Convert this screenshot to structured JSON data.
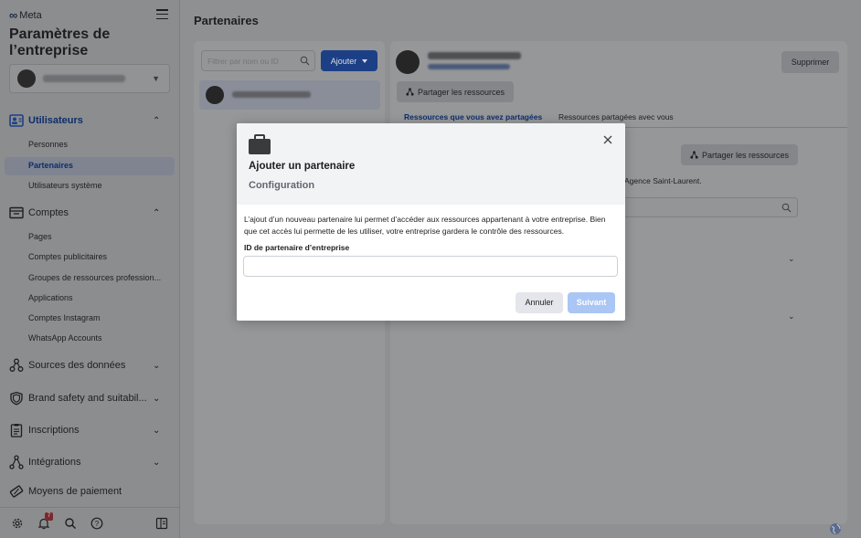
{
  "sidebar": {
    "brand": "Meta",
    "title": "Paramètres de l’entreprise",
    "account_selector": {
      "name_blurred": true
    },
    "sections": [
      {
        "id": "utilisateurs",
        "label": "Utilisateurs",
        "icon": "users-icon",
        "expanded": true,
        "active": true
      },
      {
        "id": "comptes",
        "label": "Comptes",
        "icon": "accounts-folder-icon",
        "expanded": true,
        "active": false
      },
      {
        "id": "sources",
        "label": "Sources des données",
        "icon": "data-sources-icon",
        "expanded": false,
        "active": false
      },
      {
        "id": "brand-safety",
        "label": "Brand safety and suitabil...",
        "icon": "shield-icon",
        "expanded": false,
        "active": false
      },
      {
        "id": "inscriptions",
        "label": "Inscriptions",
        "icon": "clipboard-icon",
        "expanded": false,
        "active": false
      },
      {
        "id": "integrations",
        "label": "Intégrations",
        "icon": "integrations-icon",
        "expanded": false,
        "active": false
      },
      {
        "id": "paiement",
        "label": "Moyens de paiement",
        "icon": "payment-icon",
        "expanded": false,
        "active": false
      }
    ],
    "users_items": [
      {
        "label": "Personnes",
        "active": false
      },
      {
        "label": "Partenaires",
        "active": true
      },
      {
        "label": "Utilisateurs système",
        "active": false
      }
    ],
    "accounts_items": [
      {
        "label": "Pages"
      },
      {
        "label": "Comptes publicitaires"
      },
      {
        "label": "Groupes de ressources profession..."
      },
      {
        "label": "Applications"
      },
      {
        "label": "Comptes Instagram"
      },
      {
        "label": "WhatsApp Accounts"
      }
    ],
    "bottom_icons": [
      "gear-icon",
      "bell-icon",
      "search-icon",
      "help-icon",
      "panel-toggle-icon"
    ],
    "notification_count": "7"
  },
  "main": {
    "page_title": "Partenaires",
    "filter_placeholder": "Filtrer par nom ou ID",
    "add_button": "Ajouter",
    "partner_list": [
      {
        "name_blurred": true,
        "selected": true
      }
    ],
    "detail": {
      "delete_button": "Supprimer",
      "share_button": "Partager les ressources",
      "tabs": [
        {
          "label": "Ressources que vous avez partagées",
          "active": true
        },
        {
          "label": "Ressources partagées avec vous",
          "active": false
        }
      ],
      "share_button_2": "Partager les ressources",
      "agency_text": "Agence Saint-Laurent."
    }
  },
  "modal": {
    "title": "Ajouter un partenaire",
    "subtitle": "Configuration",
    "description": "L’ajout d’un nouveau partenaire lui permet d’accéder aux ressources appartenant à votre entreprise. Bien que cet accès lui permette de les utiliser, votre entreprise gardera le contrôle des ressources.",
    "field_label": "ID de partenaire d’entreprise",
    "field_value": "",
    "cancel_button": "Annuler",
    "next_button": "Suivant"
  },
  "colors": {
    "accent": "#1d3f85",
    "next_disabled": "#a9c6f5",
    "overlay": "#8f9092"
  }
}
